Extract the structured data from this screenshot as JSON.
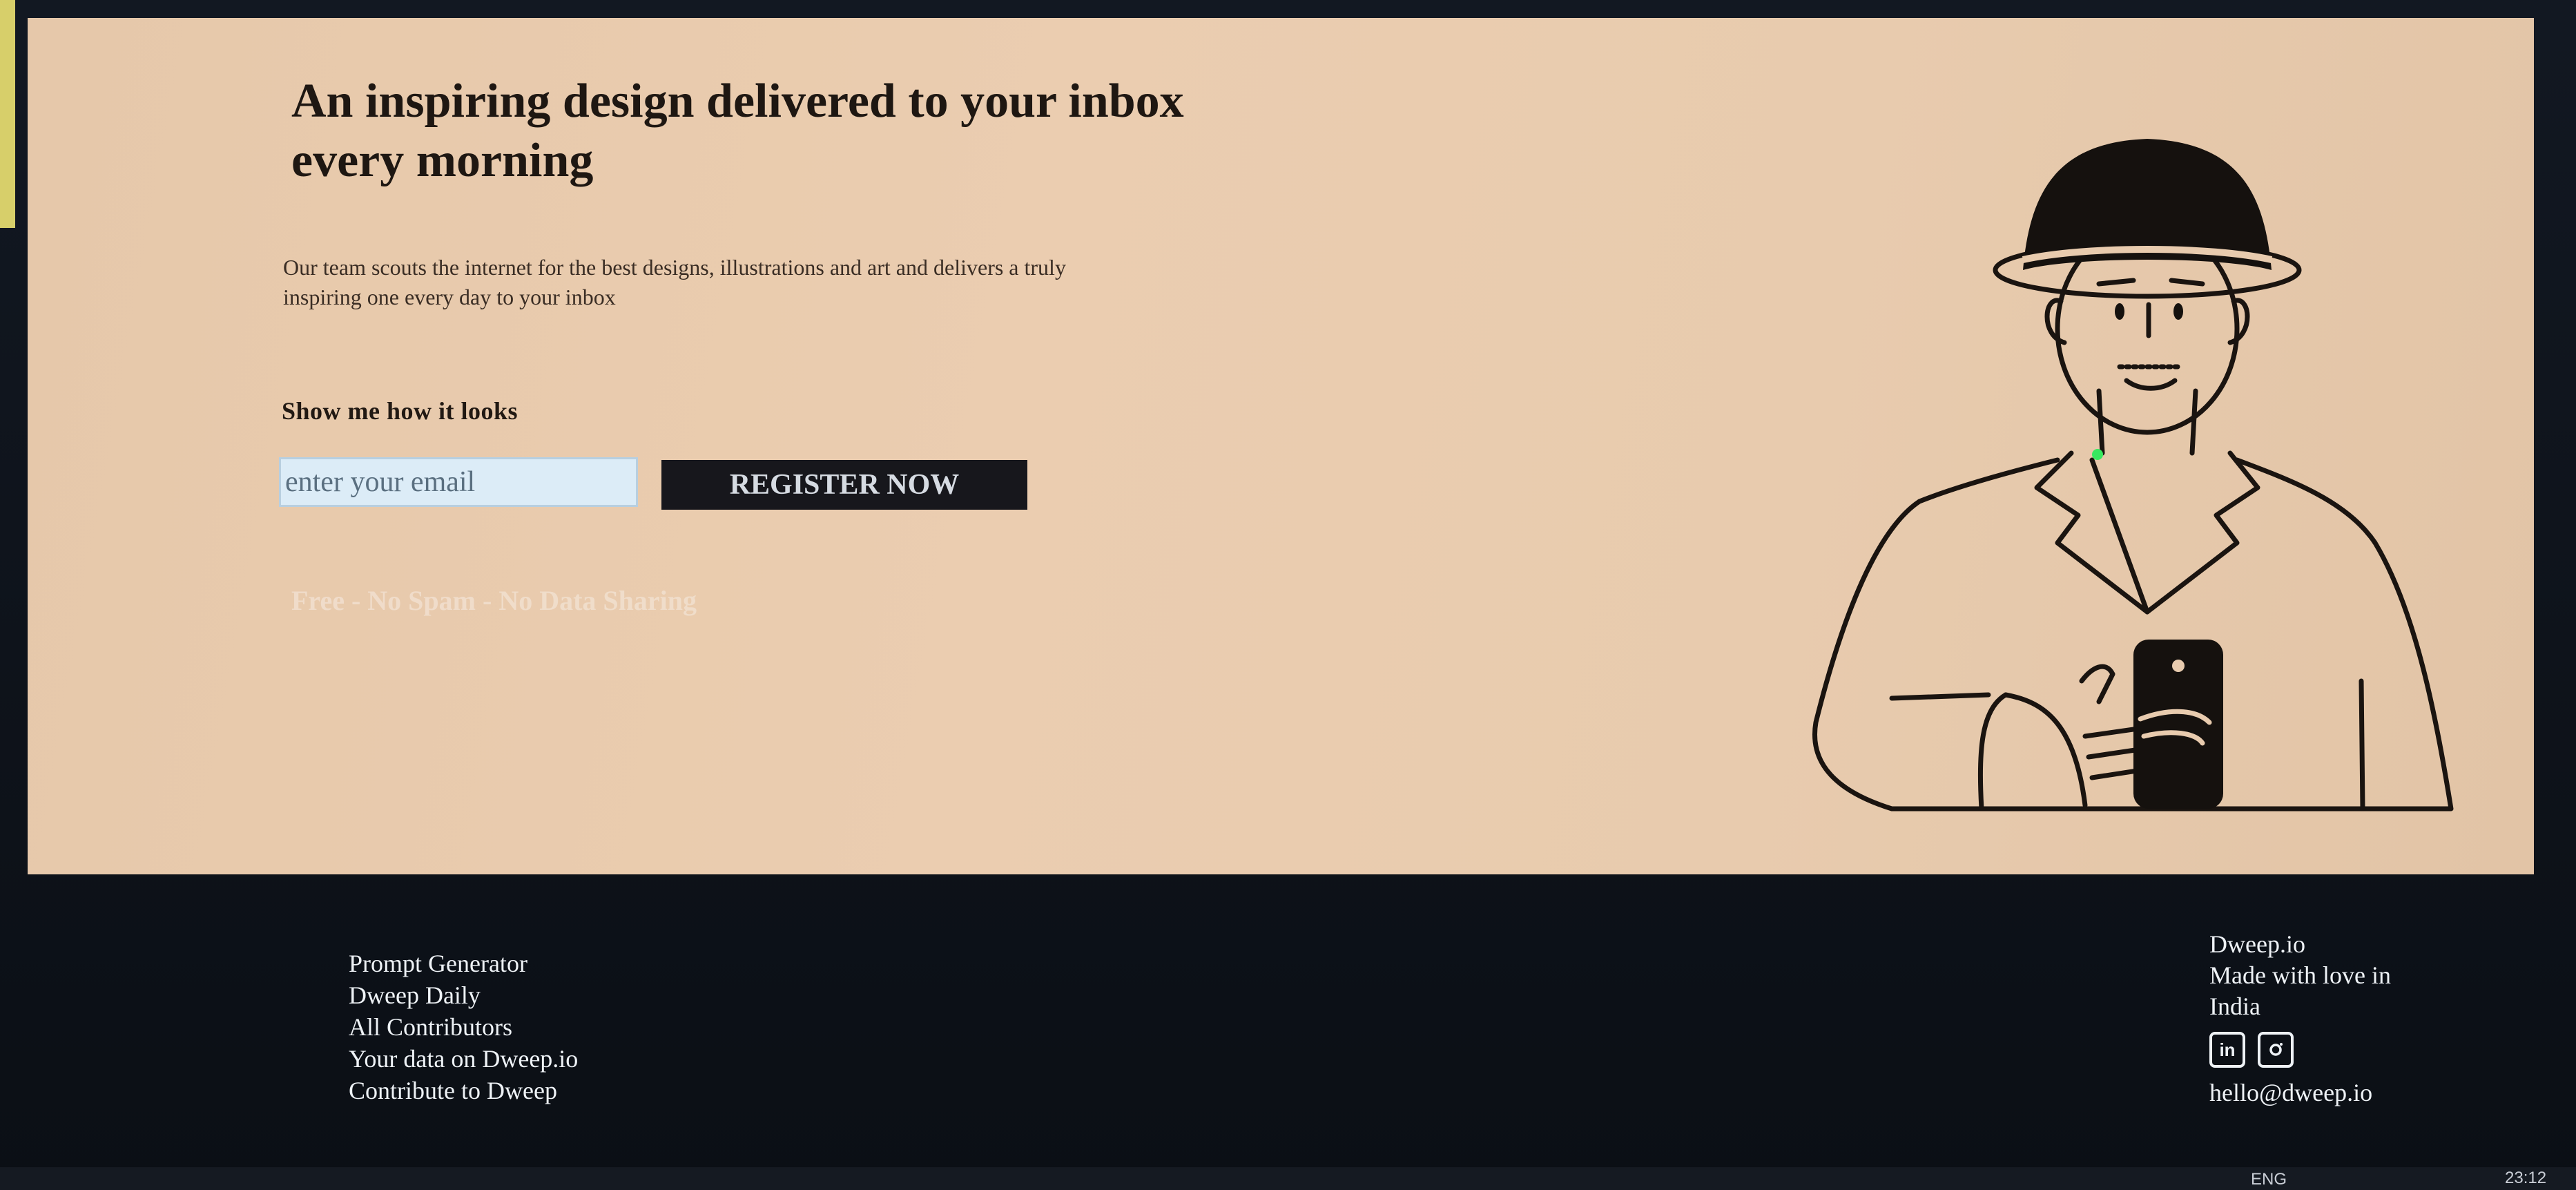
{
  "hero": {
    "headline": "An inspiring design delivered to your inbox every morning",
    "subtext": "Our team scouts the internet for the best designs, illustrations and art and delivers a truly inspiring one every day to your inbox",
    "show_me_label": "Show me how it looks",
    "email_placeholder": "enter your email",
    "register_label": "REGISTER NOW",
    "free_note": "Free - No Spam - No Data Sharing"
  },
  "footer": {
    "links": [
      "Prompt Generator",
      "Dweep Daily",
      "All Contributors",
      "Your data on Dweep.io",
      "Contribute to Dweep"
    ],
    "brand": "Dweep.io",
    "tagline": "Made with love in India",
    "social": [
      "linkedin-icon",
      "instagram-icon"
    ],
    "linkedin_glyph": "in",
    "email": "hello@dweep.io"
  },
  "taskbar": {
    "lang": "ENG",
    "time": "23:12"
  },
  "colors": {
    "hero_bg": "#e8cbae",
    "footer_bg": "#0d1117",
    "button_bg": "#17171c",
    "input_bg": "#dcecf7"
  }
}
